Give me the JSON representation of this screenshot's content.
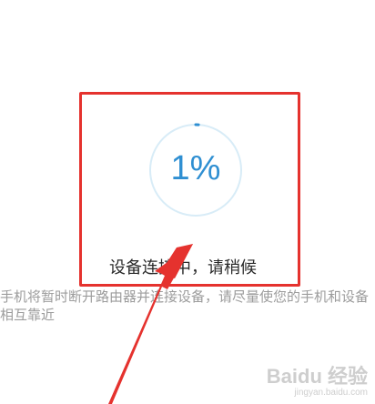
{
  "progress": {
    "percent_label": "1%",
    "fraction": 0.01
  },
  "status": {
    "connecting_label": "设备连接中，请稍候"
  },
  "hint": {
    "text": "手机将暂时断开路由器并连接设备，请尽量使您的手机和设备相互靠近"
  },
  "annotation": {
    "highlight_color": "#e5322e"
  },
  "watermark": {
    "brand": "Baidu 经验",
    "url": "jingyan.baidu.com"
  },
  "colors": {
    "accent": "#2f8fd2",
    "ring_track": "#d8ecf7"
  }
}
